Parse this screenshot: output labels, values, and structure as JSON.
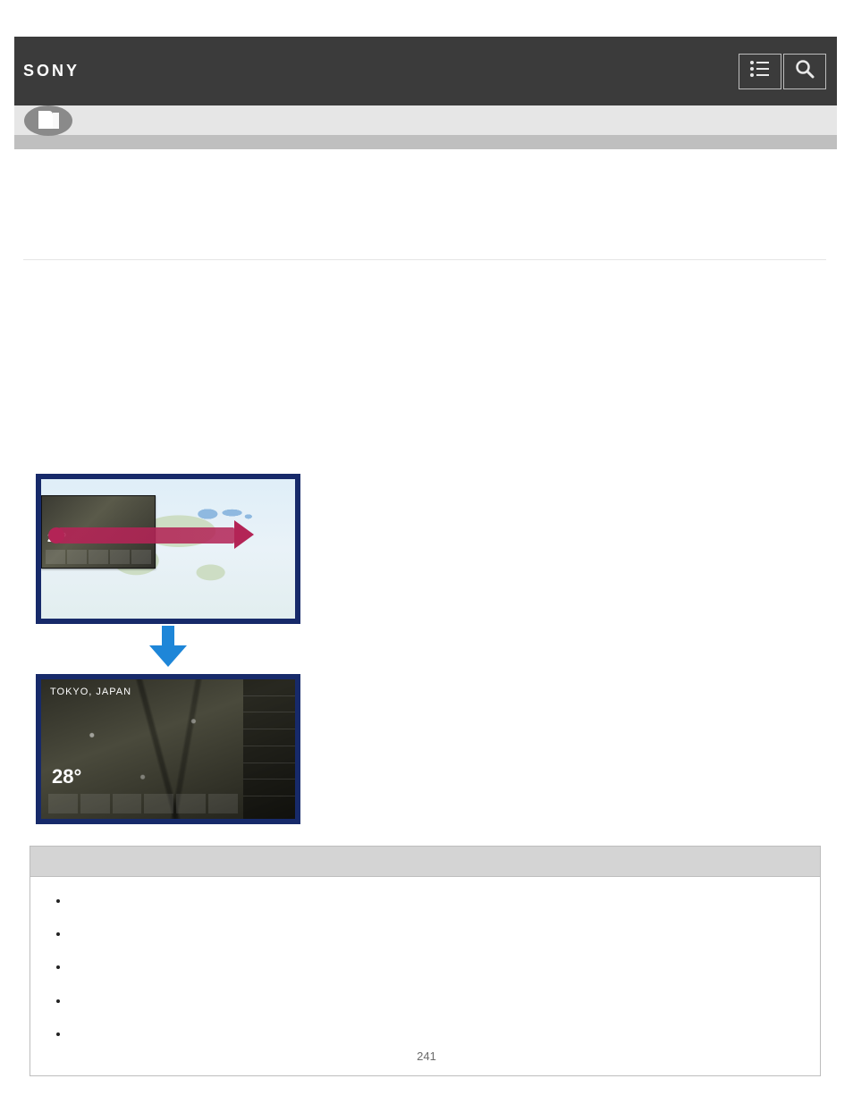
{
  "header": {
    "brand": "SONY"
  },
  "icons": {
    "menu": "menu-icon",
    "search": "search-icon",
    "user_guide": "user-guide-icon",
    "down_arrow": "down-arrow-icon",
    "swipe_arrow": "swipe-right-arrow-icon"
  },
  "figure": {
    "thumb_temp": "28°",
    "full_title": "TOKYO, JAPAN",
    "full_sub": "",
    "full_temp": "28°"
  },
  "hint": {
    "title": "",
    "items": [
      "",
      "",
      "",
      "",
      ""
    ]
  },
  "page_number": "241"
}
